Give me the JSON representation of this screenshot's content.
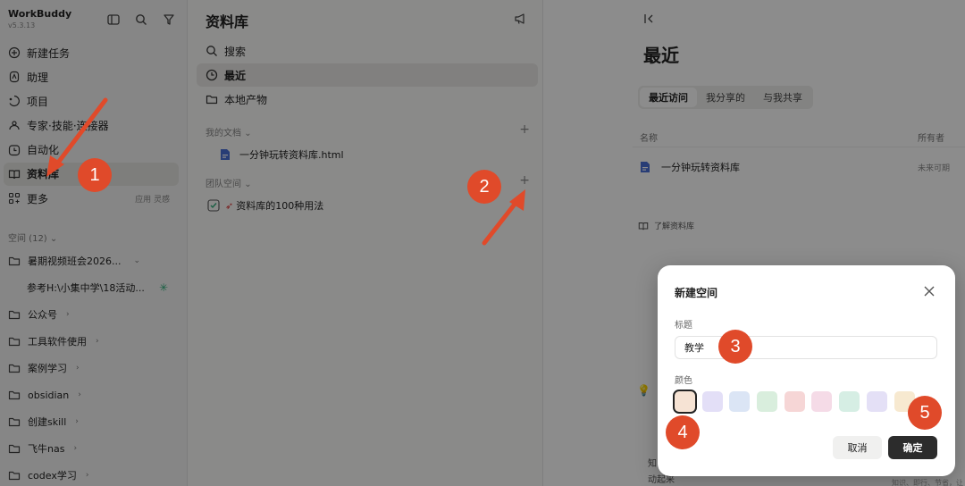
{
  "app": {
    "name": "WorkBuddy",
    "version": "v5.3.13"
  },
  "sidebar": {
    "items": [
      {
        "label": "新建任务",
        "icon": "plus-circle-icon"
      },
      {
        "label": "助理",
        "icon": "assistant-icon"
      },
      {
        "label": "项目",
        "icon": "project-icon"
      },
      {
        "label": "专家·技能·连接器",
        "icon": "expert-icon"
      },
      {
        "label": "自动化",
        "icon": "clock-icon"
      },
      {
        "label": "资料库",
        "icon": "book-icon",
        "active": true
      },
      {
        "label": "更多",
        "icon": "grid-icon",
        "extra": "应用 灵感"
      }
    ],
    "spaces_header": "空间 (12)",
    "spaces": [
      {
        "label": "暑期视频班会2026...",
        "chevron": "⌄"
      },
      {
        "label": "参考H:\\小集中学\\18活动..."
      },
      {
        "label": "公众号",
        "chevron": "›"
      },
      {
        "label": "工具软件使用",
        "chevron": "›"
      },
      {
        "label": "案例学习",
        "chevron": "›"
      },
      {
        "label": "obsidian",
        "chevron": "›"
      },
      {
        "label": "创建skill",
        "chevron": "›"
      },
      {
        "label": "飞牛nas",
        "chevron": "›"
      },
      {
        "label": "codex学习",
        "chevron": "›"
      }
    ]
  },
  "middle": {
    "title": "资料库",
    "nav": [
      {
        "label": "搜索",
        "icon": "search-icon"
      },
      {
        "label": "最近",
        "icon": "clock-icon",
        "active": true
      },
      {
        "label": "本地产物",
        "icon": "folder-icon"
      }
    ],
    "my_docs_header": "我的文档",
    "my_docs": [
      "一分钟玩转资料库.html"
    ],
    "team_header": "团队空间",
    "team_spaces": [
      "资料库的100种用法"
    ],
    "plus": "+"
  },
  "right": {
    "title": "最近",
    "tabs": [
      "最近访问",
      "我分享的",
      "与我共享"
    ],
    "col_name": "名称",
    "col_owner": "所有者",
    "file": {
      "name": "一分钟玩转资料库",
      "owner": "未来可期"
    },
    "learn_link": "了解资料库",
    "fragments": [
      "知",
      "动起来",
      "知识、即行、节省，让 Agent 安全"
    ]
  },
  "modal": {
    "title": "新建空间",
    "title_label": "标题",
    "title_value": "教学",
    "color_label": "颜色",
    "colors": [
      "#f6e3d4",
      "#e3dff7",
      "#dbe5f5",
      "#d9eedd",
      "#f6d6d6",
      "#f5dbe7",
      "#d6eee4",
      "#e4e0f6",
      "#f7e9d0"
    ],
    "cancel": "取消",
    "confirm": "确定"
  },
  "annotations": [
    "1",
    "2",
    "3",
    "4",
    "5"
  ],
  "colors": {
    "overlay": "#000000",
    "accent": "#e04a2a",
    "primary_button": "#2c2c2c"
  }
}
